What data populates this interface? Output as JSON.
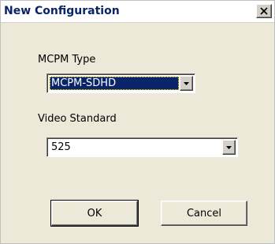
{
  "window": {
    "title": "New Configuration",
    "close_glyph": "✕"
  },
  "mcpm_type": {
    "label": "MCPM Type",
    "value": "MCPM-SDHD"
  },
  "video_standard": {
    "label": "Video Standard",
    "value": "525"
  },
  "buttons": {
    "ok_label": "OK",
    "cancel_label": "Cancel"
  },
  "icons": {
    "close": "close-icon",
    "dropdown": "chevron-down-icon"
  },
  "colors": {
    "title_text": "#0a246a",
    "dialog_face": "#ece9d8",
    "selection_bg": "#0a246a",
    "selection_text": "#ffffff"
  }
}
